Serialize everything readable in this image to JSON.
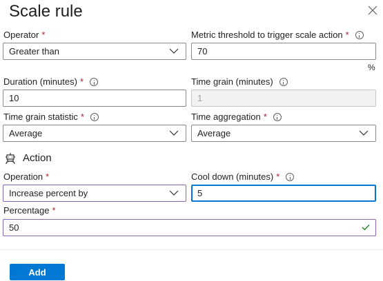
{
  "panel": {
    "title": "Scale rule"
  },
  "fields": {
    "operator": {
      "label": "Operator",
      "value": "Greater than"
    },
    "metric_threshold": {
      "label": "Metric threshold to trigger scale action",
      "value": "70",
      "unit": "%"
    },
    "duration": {
      "label": "Duration (minutes)",
      "value": "10"
    },
    "time_grain": {
      "label": "Time grain (minutes)",
      "value": "1"
    },
    "time_grain_statistic": {
      "label": "Time grain statistic",
      "value": "Average"
    },
    "time_aggregation": {
      "label": "Time aggregation",
      "value": "Average"
    }
  },
  "action": {
    "heading": "Action",
    "operation": {
      "label": "Operation",
      "value": "Increase percent by"
    },
    "cool_down": {
      "label": "Cool down (minutes)",
      "value": "5"
    },
    "percentage": {
      "label": "Percentage",
      "value": "50"
    }
  },
  "footer": {
    "add_label": "Add"
  },
  "required_marker": "*",
  "colors": {
    "accent": "#0078d4",
    "required": "#a4262c",
    "valid": "#107c10",
    "highlight_border": "#8764b8"
  }
}
